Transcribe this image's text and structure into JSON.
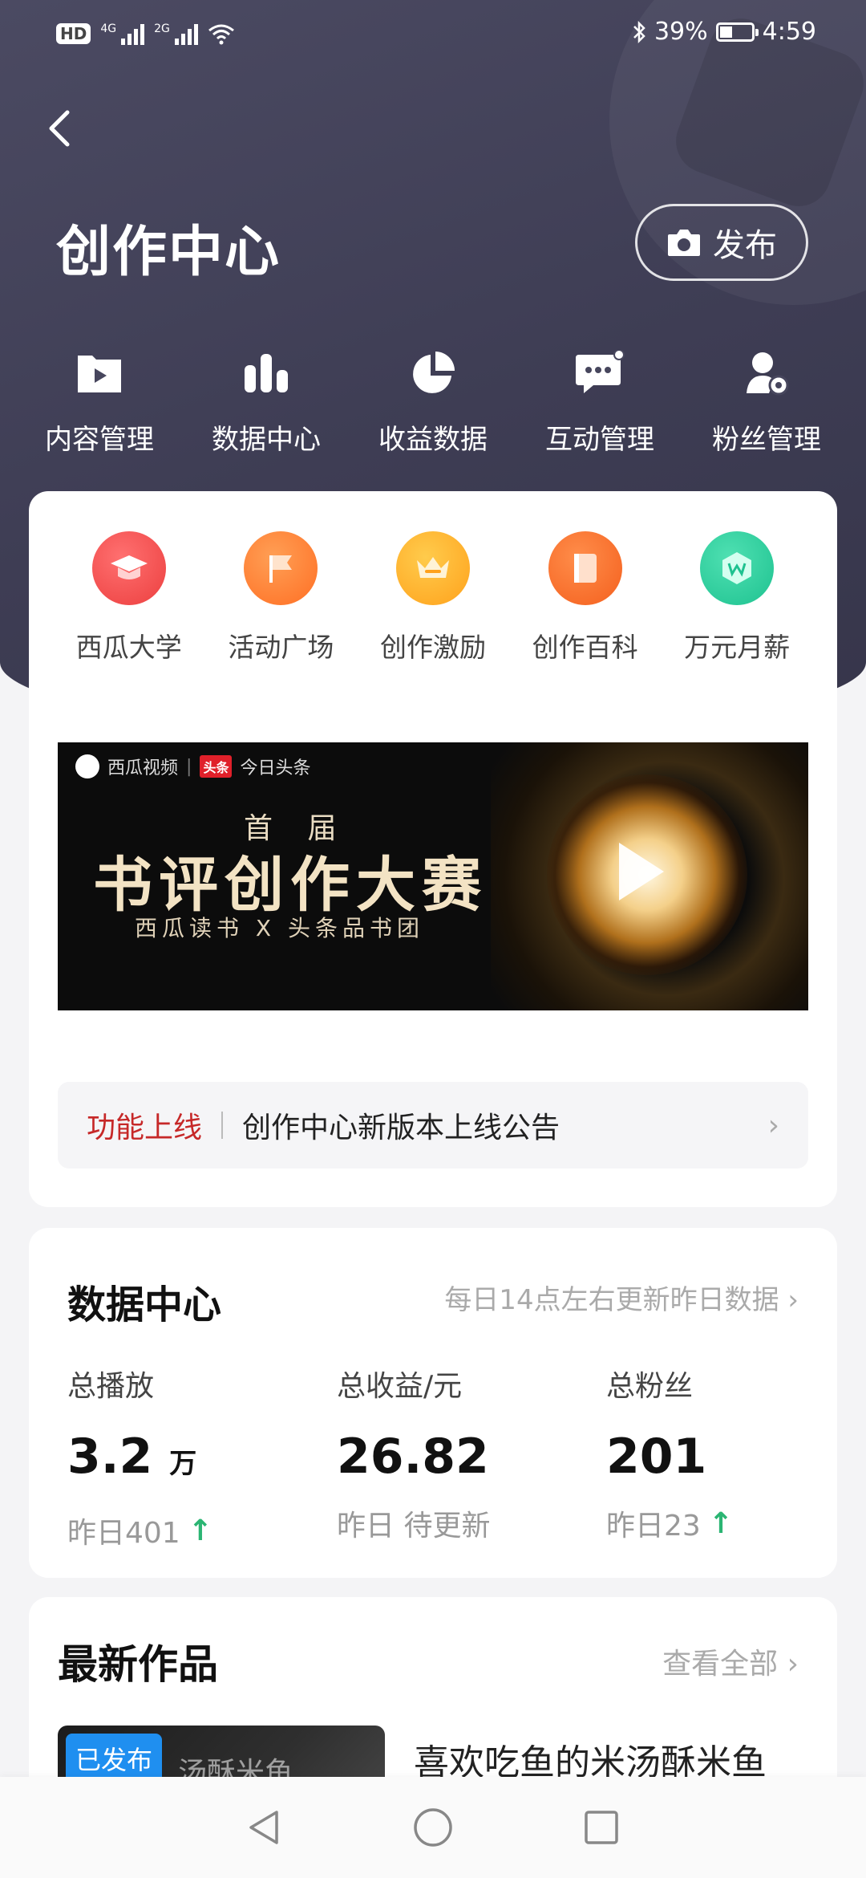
{
  "status_bar": {
    "hd": "HD",
    "sim1": "4G",
    "sim2": "2G",
    "battery": "39%",
    "battery_level": 0.39,
    "time": "4:59"
  },
  "header": {
    "title": "创作中心",
    "publish_label": "发布"
  },
  "top_nav": [
    {
      "label": "内容管理",
      "icon": "play-video-icon"
    },
    {
      "label": "数据中心",
      "icon": "bar-chart-icon"
    },
    {
      "label": "收益数据",
      "icon": "pie-chart-icon"
    },
    {
      "label": "互动管理",
      "icon": "chat-bubble-icon"
    },
    {
      "label": "粉丝管理",
      "icon": "user-settings-icon"
    }
  ],
  "shortcuts": [
    {
      "label": "西瓜大学",
      "icon": "graduation-cap-icon",
      "color": "#f04e4e"
    },
    {
      "label": "活动广场",
      "icon": "flag-icon",
      "color": "#ff7a2e"
    },
    {
      "label": "创作激励",
      "icon": "crown-icon",
      "color": "#ffb02a"
    },
    {
      "label": "创作百科",
      "icon": "book-icon",
      "color": "#ff6a2a"
    },
    {
      "label": "万元月薪",
      "icon": "w-coin-icon",
      "color": "#2fcf9f"
    }
  ],
  "banner": {
    "brand": "西瓜视频",
    "brand_badge": "头条",
    "brand2": "今日头条",
    "subtitle": "首 届",
    "title": "书评创作大赛",
    "tagline": "西瓜读书 X 头条品书团"
  },
  "notice": {
    "tag": "功能上线",
    "text": "创作中心新版本上线公告"
  },
  "data_center": {
    "title": "数据中心",
    "hint": "每日14点左右更新昨日数据",
    "stats": [
      {
        "label": "总播放",
        "value": "3.2",
        "unit": "万",
        "sub": "昨日401",
        "trend": "up"
      },
      {
        "label": "总收益/元",
        "value": "26.82",
        "unit": "",
        "sub": "昨日 待更新",
        "trend": ""
      },
      {
        "label": "总粉丝",
        "value": "201",
        "unit": "",
        "sub": "昨日23",
        "trend": "up"
      }
    ]
  },
  "latest_works": {
    "title": "最新作品",
    "more": "查看全部",
    "items": [
      {
        "badge": "已发布",
        "thumb_text": "汤酥米鱼",
        "title": "喜欢吃鱼的米汤酥米鱼"
      }
    ]
  }
}
